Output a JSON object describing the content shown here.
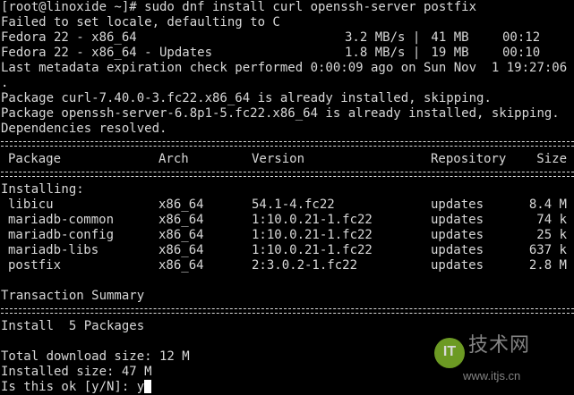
{
  "lines": {
    "l0": "[root@linoxide ~]# sudo dnf install curl openssh-server postfix",
    "l1": "Failed to set locale, defaulting to C",
    "l4": "Last metadata expiration check performed 0:00:09 ago on Sun Nov  1 19:27:06 2015",
    "l5": ".",
    "l6": "Package curl-7.40.0-3.fc22.x86_64 is already installed, skipping.",
    "l7": "Package openssh-server-6.8p1-5.fc22.x86_64 is already installed, skipping.",
    "l8": "Dependencies resolved.",
    "installing": "Installing:",
    "summary": "Transaction Summary",
    "install_count": "Install  5 Packages",
    "download_size": "Total download size: 12 M",
    "installed_size": "Installed size: 47 M",
    "prompt": "Is this ok [y/N]: ",
    "answer": "y"
  },
  "repos": [
    {
      "name": "Fedora 22 - x86_64",
      "speed": "3.2 MB/s |",
      "size": " 41 MB",
      "time": "00:12"
    },
    {
      "name": "Fedora 22 - x86_64 - Updates",
      "speed": "1.8 MB/s |",
      "size": " 19 MB",
      "time": "00:10"
    }
  ],
  "table": {
    "headers": {
      "package": "Package",
      "arch": "Arch",
      "version": "Version",
      "repository": "Repository",
      "size": "Size"
    },
    "rows": [
      {
        "package": "libicu",
        "arch": "x86_64",
        "version": "54.1-4.fc22",
        "repository": "updates",
        "size": "8.4 M"
      },
      {
        "package": "mariadb-common",
        "arch": "x86_64",
        "version": "1:10.0.21-1.fc22",
        "repository": "updates",
        "size": "74 k"
      },
      {
        "package": "mariadb-config",
        "arch": "x86_64",
        "version": "1:10.0.21-1.fc22",
        "repository": "updates",
        "size": "25 k"
      },
      {
        "package": "mariadb-libs",
        "arch": "x86_64",
        "version": "1:10.0.21-1.fc22",
        "repository": "updates",
        "size": "637 k"
      },
      {
        "package": "postfix",
        "arch": "x86_64",
        "version": "2:3.0.2-1.fc22",
        "repository": "updates",
        "size": "2.8 M"
      }
    ]
  },
  "watermark": {
    "badge": "IT",
    "title": "技术网",
    "url": "www.itjs.cn"
  },
  "colors": {
    "background": "#000000",
    "foreground": "#d8d8d8",
    "cursor": "#ffffff",
    "watermark_badge": "#7fb52a"
  }
}
